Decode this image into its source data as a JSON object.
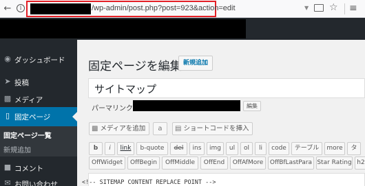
{
  "browser": {
    "url_text": "/wp-admin/post.php?post=923&action=edit"
  },
  "sidebar": {
    "items": [
      {
        "label": "ダッシュボード",
        "icon": "dashboard-icon"
      },
      {
        "label": "投稿",
        "icon": "pin-icon"
      },
      {
        "label": "メディア",
        "icon": "media-icon"
      },
      {
        "label": "固定ページ",
        "icon": "page-icon"
      },
      {
        "label": "コメント",
        "icon": "comment-icon"
      },
      {
        "label": "お問い合わせ",
        "icon": "mail-icon"
      }
    ],
    "current_index": 3,
    "submenu": [
      {
        "label": "固定ページ一覧"
      },
      {
        "label": "新規追加"
      }
    ]
  },
  "main": {
    "page_title": "固定ページを編集",
    "add_new_label": "新規追加",
    "post_title": "サイトマップ",
    "permalink_label": "パーマリンク:",
    "edit_slug_label": "編集",
    "media_button_label": "メディアを追加",
    "a_button_label": "a",
    "shortcode_button_label": "ショートコードを挿入",
    "quicktags_row1": [
      "b",
      "i",
      "link",
      "b-quote",
      "del",
      "ins",
      "img",
      "ul",
      "ol",
      "li",
      "code",
      "テーブル",
      "more",
      "タ"
    ],
    "quicktags_row2": [
      "OffWidget",
      "OffBegin",
      "OffMiddle",
      "OffEnd",
      "OffAfMore",
      "OffBfLastPara",
      "Star Rating",
      "h2"
    ],
    "editor_content": "<!-- SITEMAP CONTENT REPLACE POINT -->"
  },
  "colors": {
    "accent": "#0073aa",
    "admin_bar": "#23282d",
    "highlight_border": "#e41f26"
  }
}
